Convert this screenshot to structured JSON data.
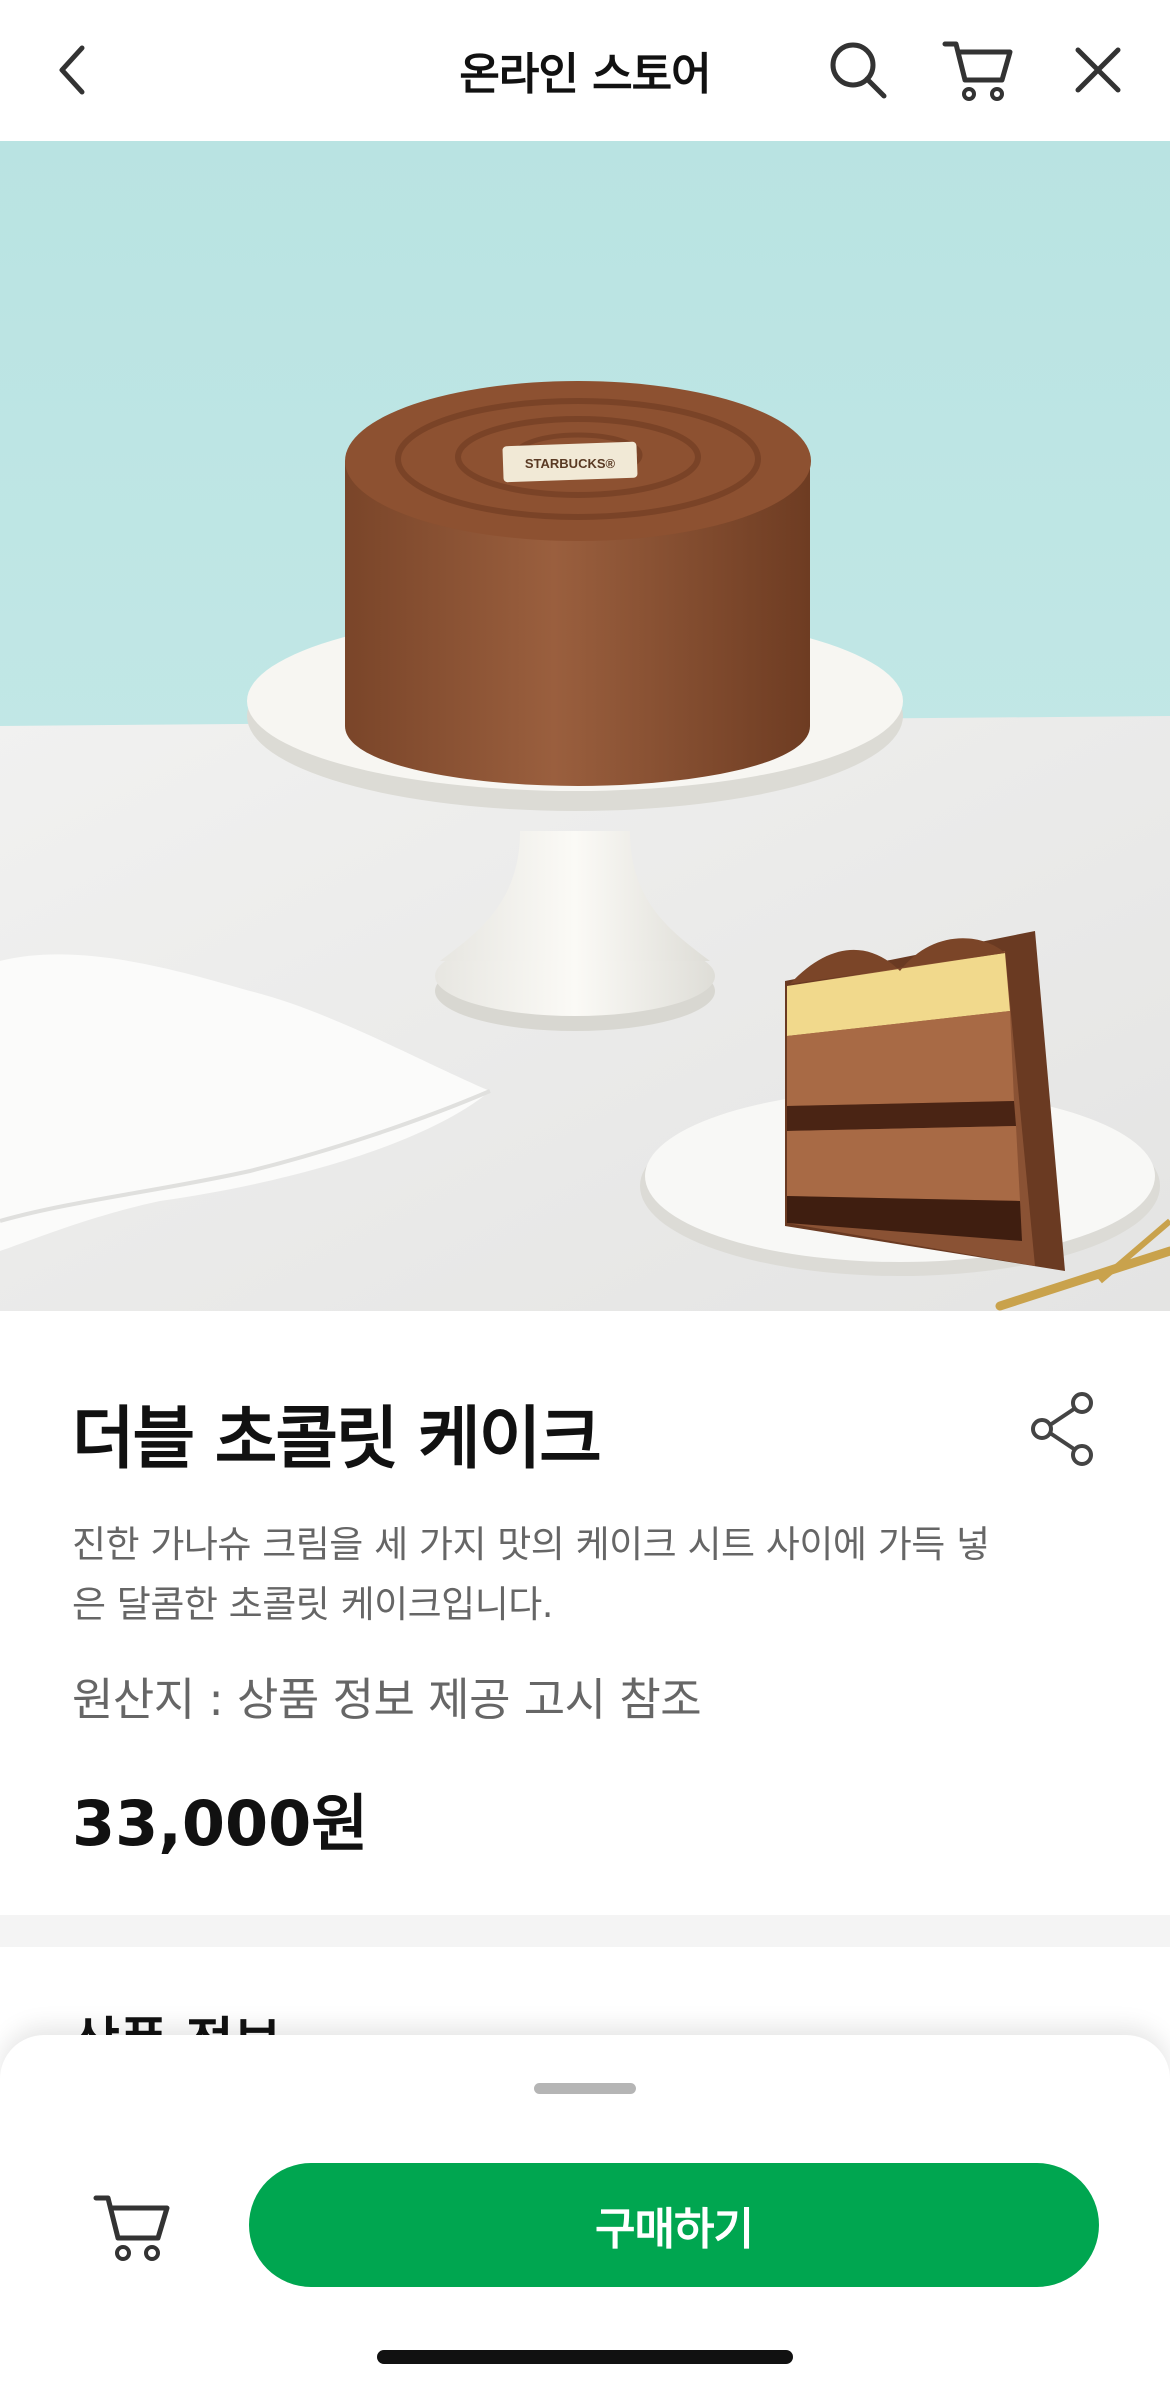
{
  "nav": {
    "title": "온라인 스토어",
    "icons": [
      "back-chevron-icon",
      "search-icon",
      "cart-icon",
      "close-icon"
    ]
  },
  "hero": {
    "cake_plaque_text": "STARBUCKS®"
  },
  "product": {
    "name": "더블 초콜릿 케이크",
    "description_line1": "진한 가나슈 크림을 세 가지 맛의 케이크 시트 사이에 가득 넣",
    "description_line2": "은 달콤한 초콜릿 케이크입니다.",
    "origin": "원산지 : 상품 정보 제공 고시 참조",
    "price": "33,000원"
  },
  "section": {
    "title": "상품 정보"
  },
  "bottom_bar": {
    "buy_label": "구매하기"
  },
  "colors": {
    "brand_green": "#00a650",
    "text_primary": "#111111",
    "text_secondary": "#666666",
    "hero_wall": "#bfe6e4",
    "hero_table": "#ededec",
    "cake_brown": "#8a5234"
  }
}
